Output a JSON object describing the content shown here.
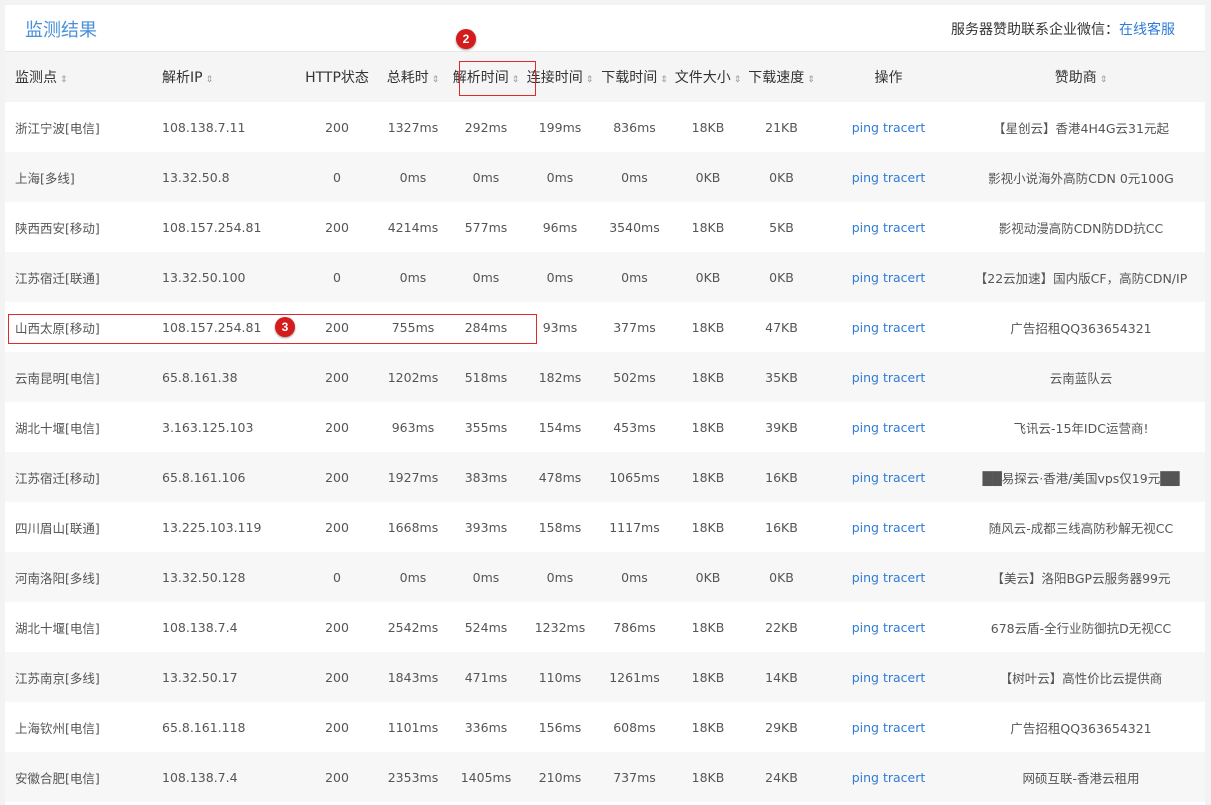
{
  "panel": {
    "title": "监测结果",
    "sponsor_label": "服务器赞助联系企业微信：",
    "sponsor_link": "在线客服"
  },
  "table": {
    "columns": [
      {
        "label": "监测点",
        "sortable": true
      },
      {
        "label": "解析IP",
        "sortable": true
      },
      {
        "label": "HTTP状态",
        "sortable": false
      },
      {
        "label": "总耗时",
        "sortable": true
      },
      {
        "label": "解析时间",
        "sortable": true
      },
      {
        "label": "连接时间",
        "sortable": true
      },
      {
        "label": "下载时间",
        "sortable": true
      },
      {
        "label": "文件大小",
        "sortable": true
      },
      {
        "label": "下载速度",
        "sortable": true
      },
      {
        "label": "操作",
        "sortable": false
      },
      {
        "label": "赞助商",
        "sortable": true
      }
    ],
    "rows": [
      {
        "node": "浙江宁波[电信]",
        "ip": "108.138.7.11",
        "status": "200",
        "total": "1327ms",
        "dns": "292ms",
        "connect": "199ms",
        "download": "836ms",
        "size": "18KB",
        "speed": "21KB",
        "sponsor": "【星创云】香港4H4G云31元起"
      },
      {
        "node": "上海[多线]",
        "ip": "13.32.50.8",
        "status": "0",
        "total": "0ms",
        "dns": "0ms",
        "connect": "0ms",
        "download": "0ms",
        "size": "0KB",
        "speed": "0KB",
        "sponsor": "影视小说海外高防CDN 0元100G"
      },
      {
        "node": "陕西西安[移动]",
        "ip": "108.157.254.81",
        "status": "200",
        "total": "4214ms",
        "dns": "577ms",
        "connect": "96ms",
        "download": "3540ms",
        "size": "18KB",
        "speed": "5KB",
        "sponsor": "影视动漫高防CDN防DD抗CC"
      },
      {
        "node": "江苏宿迁[联通]",
        "ip": "13.32.50.100",
        "status": "0",
        "total": "0ms",
        "dns": "0ms",
        "connect": "0ms",
        "download": "0ms",
        "size": "0KB",
        "speed": "0KB",
        "sponsor": "【22云加速】国内版CF，高防CDN/IP"
      },
      {
        "node": "山西太原[移动]",
        "ip": "108.157.254.81",
        "status": "200",
        "total": "755ms",
        "dns": "284ms",
        "connect": "93ms",
        "download": "377ms",
        "size": "18KB",
        "speed": "47KB",
        "sponsor": "广告招租QQ363654321"
      },
      {
        "node": "云南昆明[电信]",
        "ip": "65.8.161.38",
        "status": "200",
        "total": "1202ms",
        "dns": "518ms",
        "connect": "182ms",
        "download": "502ms",
        "size": "18KB",
        "speed": "35KB",
        "sponsor": "云南蓝队云"
      },
      {
        "node": "湖北十堰[电信]",
        "ip": "3.163.125.103",
        "status": "200",
        "total": "963ms",
        "dns": "355ms",
        "connect": "154ms",
        "download": "453ms",
        "size": "18KB",
        "speed": "39KB",
        "sponsor": "飞讯云-15年IDC运营商!"
      },
      {
        "node": "江苏宿迁[移动]",
        "ip": "65.8.161.106",
        "status": "200",
        "total": "1927ms",
        "dns": "383ms",
        "connect": "478ms",
        "download": "1065ms",
        "size": "18KB",
        "speed": "16KB",
        "sponsor": "██易探云·香港/美国vps仅19元██"
      },
      {
        "node": "四川眉山[联通]",
        "ip": "13.225.103.119",
        "status": "200",
        "total": "1668ms",
        "dns": "393ms",
        "connect": "158ms",
        "download": "1117ms",
        "size": "18KB",
        "speed": "16KB",
        "sponsor": "随风云-成都三线高防秒解无视CC"
      },
      {
        "node": "河南洛阳[多线]",
        "ip": "13.32.50.128",
        "status": "0",
        "total": "0ms",
        "dns": "0ms",
        "connect": "0ms",
        "download": "0ms",
        "size": "0KB",
        "speed": "0KB",
        "sponsor": "【美云】洛阳BGP云服务器99元"
      },
      {
        "node": "湖北十堰[电信]",
        "ip": "108.138.7.4",
        "status": "200",
        "total": "2542ms",
        "dns": "524ms",
        "connect": "1232ms",
        "download": "786ms",
        "size": "18KB",
        "speed": "22KB",
        "sponsor": "678云盾-全行业防御抗D无视CC"
      },
      {
        "node": "江苏南京[多线]",
        "ip": "13.32.50.17",
        "status": "200",
        "total": "1843ms",
        "dns": "471ms",
        "connect": "110ms",
        "download": "1261ms",
        "size": "18KB",
        "speed": "14KB",
        "sponsor": "【树叶云】高性价比云提供商"
      },
      {
        "node": "上海钦州[电信]",
        "ip": "65.8.161.118",
        "status": "200",
        "total": "1101ms",
        "dns": "336ms",
        "connect": "156ms",
        "download": "608ms",
        "size": "18KB",
        "speed": "29KB",
        "sponsor": "广告招租QQ363654321"
      },
      {
        "node": "安徽合肥[电信]",
        "ip": "108.138.7.4",
        "status": "200",
        "total": "2353ms",
        "dns": "1405ms",
        "connect": "210ms",
        "download": "737ms",
        "size": "18KB",
        "speed": "24KB",
        "sponsor": "网硕互联-香港云租用"
      }
    ],
    "actions": {
      "ping": "ping",
      "tracert": "tracert"
    },
    "sort_icon": "⇕"
  },
  "annotations": [
    {
      "label": "2",
      "target": "解析时间 column header"
    },
    {
      "label": "3",
      "target": "山西太原[移动] row"
    }
  ],
  "colors": {
    "accent": "#4a90d9",
    "link": "#2f7bd6",
    "annotation": "#e0282d"
  }
}
